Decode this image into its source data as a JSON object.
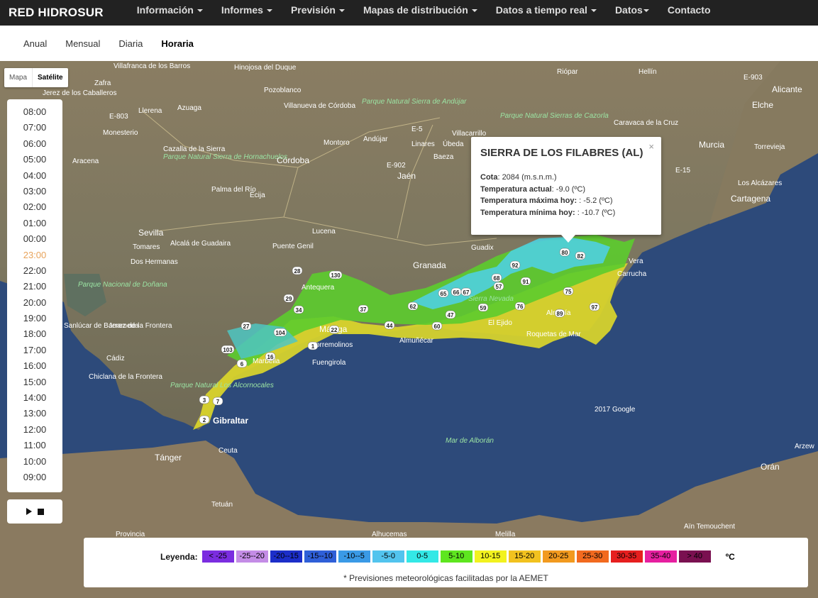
{
  "brand": "RED HIDROSUR",
  "nav": [
    {
      "label": "Información",
      "dropdown": true
    },
    {
      "label": "Informes",
      "dropdown": true
    },
    {
      "label": "Previsión",
      "dropdown": true
    },
    {
      "label": "Mapas de distribución",
      "dropdown": true
    },
    {
      "label": "Datos a tiempo real",
      "dropdown": true
    },
    {
      "label": "Datos",
      "dropdown": true
    },
    {
      "label": "Contacto",
      "dropdown": false
    }
  ],
  "subtabs": [
    {
      "label": "Anual",
      "active": false
    },
    {
      "label": "Mensual",
      "active": false
    },
    {
      "label": "Diaria",
      "active": false
    },
    {
      "label": "Horaria",
      "active": true
    }
  ],
  "map_type": {
    "map_label": "Mapa",
    "satellite_label": "Satélite",
    "selected": "Satélite"
  },
  "time_panel": {
    "hours": [
      "08:00",
      "07:00",
      "06:00",
      "05:00",
      "04:00",
      "03:00",
      "02:00",
      "01:00",
      "00:00",
      "23:00",
      "22:00",
      "21:00",
      "20:00",
      "19:00",
      "18:00",
      "17:00",
      "16:00",
      "15:00",
      "14:00",
      "13:00",
      "12:00",
      "11:00",
      "10:00",
      "09:00"
    ],
    "current": "23:00",
    "current_color": "#e8a35a"
  },
  "player": {
    "play_icon": "play-icon",
    "stop_icon": "stop-icon"
  },
  "infowindow": {
    "title": "SIERRA DE LOS FILABRES (AL)",
    "close_label": "×",
    "cota_label": "Cota",
    "cota_value": ": 2084 (m.s.n.m.)",
    "actual_label": "Temperatura actual",
    "actual_value": ": -9.0 (ºC)",
    "max_label": "Temperatura máxima hoy:",
    "max_value": " : -5.2 (ºC)",
    "min_label": "Temperatura mínima hoy:",
    "min_value": " : -10.7 (ºC)"
  },
  "legend": {
    "title": "Leyenda:",
    "unit": "ºC",
    "note": "* Previsiones meteorológicas facilitadas por la AEMET",
    "items": [
      {
        "label": "< -25",
        "color": "#7b2de0"
      },
      {
        "label": "-25--20",
        "color": "#c48ce6"
      },
      {
        "label": "-20--15",
        "color": "#1c2ec9"
      },
      {
        "label": "-15--10",
        "color": "#2f5fd8"
      },
      {
        "label": "-10--5",
        "color": "#3a9ae6"
      },
      {
        "label": "-5-0",
        "color": "#52c4ee"
      },
      {
        "label": "0-5",
        "color": "#33e8e6"
      },
      {
        "label": "5-10",
        "color": "#5ee61f"
      },
      {
        "label": "10-15",
        "color": "#f2f21f"
      },
      {
        "label": "15-20",
        "color": "#f2c21f"
      },
      {
        "label": "20-25",
        "color": "#f29a1f"
      },
      {
        "label": "25-30",
        "color": "#f26a1f"
      },
      {
        "label": "30-35",
        "color": "#e61f1f"
      },
      {
        "label": "35-40",
        "color": "#e61fa0"
      },
      {
        "label": "> 40",
        "color": "#7a1050"
      }
    ]
  },
  "map_labels": {
    "cities": [
      "Villafranca de los Barros",
      "Hinojosa del Duque",
      "Zafra",
      "Pozoblanco",
      "Jerez de los Caballeros",
      "Llerena",
      "Azuaga",
      "Villanueva de Córdoba",
      "Monesterio",
      "Cazalla de la Sierra",
      "Montoro",
      "Andújar",
      "Linares",
      "Úbeda",
      "Villacarrillo",
      "Baeza",
      "Jaén",
      "Córdoba",
      "Aracena",
      "Palma del Río",
      "Écija",
      "Sevilla",
      "Tomares",
      "Alcalá de Guadaira",
      "Dos Hermanas",
      "Lucena",
      "Puente Genil",
      "Granada",
      "Guadix",
      "Antequera",
      "Málaga",
      "Torremolinos",
      "Fuengirola",
      "Marbella",
      "Sanlúcar de Barrameda",
      "Jerez de la Frontera",
      "Cádiz",
      "Chiclana de la Frontera",
      "Almuñécar",
      "El Ejido",
      "Roquetas de Mar",
      "Almería",
      "Vera",
      "Carrucha",
      "Hellín",
      "Elche",
      "Alicante",
      "Caravaca de la Cruz",
      "Murcia",
      "Torrevieja",
      "Los Alcázares",
      "Cartagena",
      "Tánger",
      "Ceuta",
      "Tetuán",
      "Orán",
      "Arzew",
      "Aïn Temouchent",
      "Alhucemas",
      "Melilla",
      "Gibraltar",
      "Riópar",
      "Provincia"
    ],
    "parks": [
      "Parque Natural Sierra de Andújar",
      "Parque Natural Sierras de Cazorla",
      "Parque Natural Sierra de Hornachuelos",
      "Parque Nacional de Doñana",
      "Parque Natural Los Alcornocales",
      "Sierra Nevada"
    ],
    "roads": [
      "E-803",
      "E-5",
      "E-902",
      "E-15",
      "E-903"
    ],
    "sea": "Mar de Alborán",
    "copyright": "2017 Google"
  },
  "stations": [
    "28",
    "130",
    "29",
    "34",
    "37",
    "27",
    "104",
    "22",
    "103",
    "16",
    "6",
    "1",
    "44",
    "62",
    "65",
    "66",
    "67",
    "47",
    "59",
    "60",
    "68",
    "57",
    "92",
    "91",
    "76",
    "75",
    "89",
    "97",
    "80",
    "82",
    "3",
    "7",
    "2"
  ]
}
